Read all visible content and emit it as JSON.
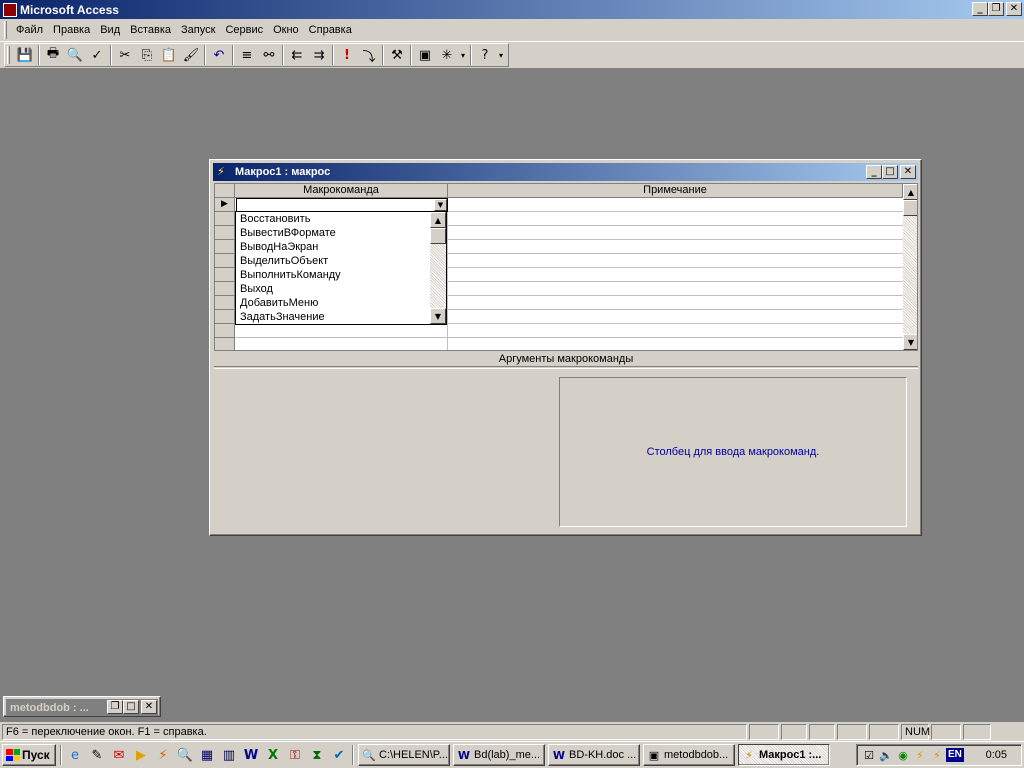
{
  "app": {
    "title": "Microsoft Access"
  },
  "menu": [
    {
      "label": "Файл"
    },
    {
      "label": "Правка"
    },
    {
      "label": "Вид"
    },
    {
      "label": "Вставка"
    },
    {
      "label": "Запуск"
    },
    {
      "label": "Сервис"
    },
    {
      "label": "Окно"
    },
    {
      "label": "Справка"
    }
  ],
  "toolbar": {
    "icons": [
      "save-icon",
      "print-icon",
      "print-preview-icon",
      "spelling-icon",
      "cut-icon",
      "copy-icon",
      "paste-icon",
      "format-painter-icon",
      "undo-icon",
      "macro-names-icon",
      "conditions-icon",
      "insert-row-icon",
      "delete-row-icon",
      "run-icon",
      "single-step-icon",
      "build-icon",
      "database-window-icon",
      "new-object-icon",
      "help-icon"
    ]
  },
  "macro_window": {
    "title": "Макрос1 : макрос",
    "col_action": "Макрокоманда",
    "col_comment": "Примечание",
    "dropdown_items": [
      "Восстановить",
      "ВывестиВФормате",
      "ВыводНаЭкран",
      "ВыделитьОбъект",
      "ВыполнитьКоманду",
      "Выход",
      "ДобавитьМеню",
      "ЗадатьЗначение"
    ],
    "args_label": "Аргументы макрокоманды",
    "hint": "Столбец для ввода макрокоманд."
  },
  "minimized_window": {
    "title": "metodbdob : ..."
  },
  "status": {
    "text": "F6 = переключение окон.  F1 = справка.",
    "num": "NUM"
  },
  "taskbar": {
    "start": "Пуск",
    "tasks": [
      {
        "label": "C:\\HELEN\\P...",
        "icon": "explorer-icon"
      },
      {
        "label": "Bd(lab)_me...",
        "icon": "word-icon"
      },
      {
        "label": "BD-KH.doc ...",
        "icon": "word-icon"
      },
      {
        "label": "metodbdob...",
        "icon": "access-icon"
      },
      {
        "label": "Макрос1 :...",
        "icon": "macro-icon",
        "active": true
      }
    ],
    "lang": "EN",
    "clock": "0:05"
  }
}
